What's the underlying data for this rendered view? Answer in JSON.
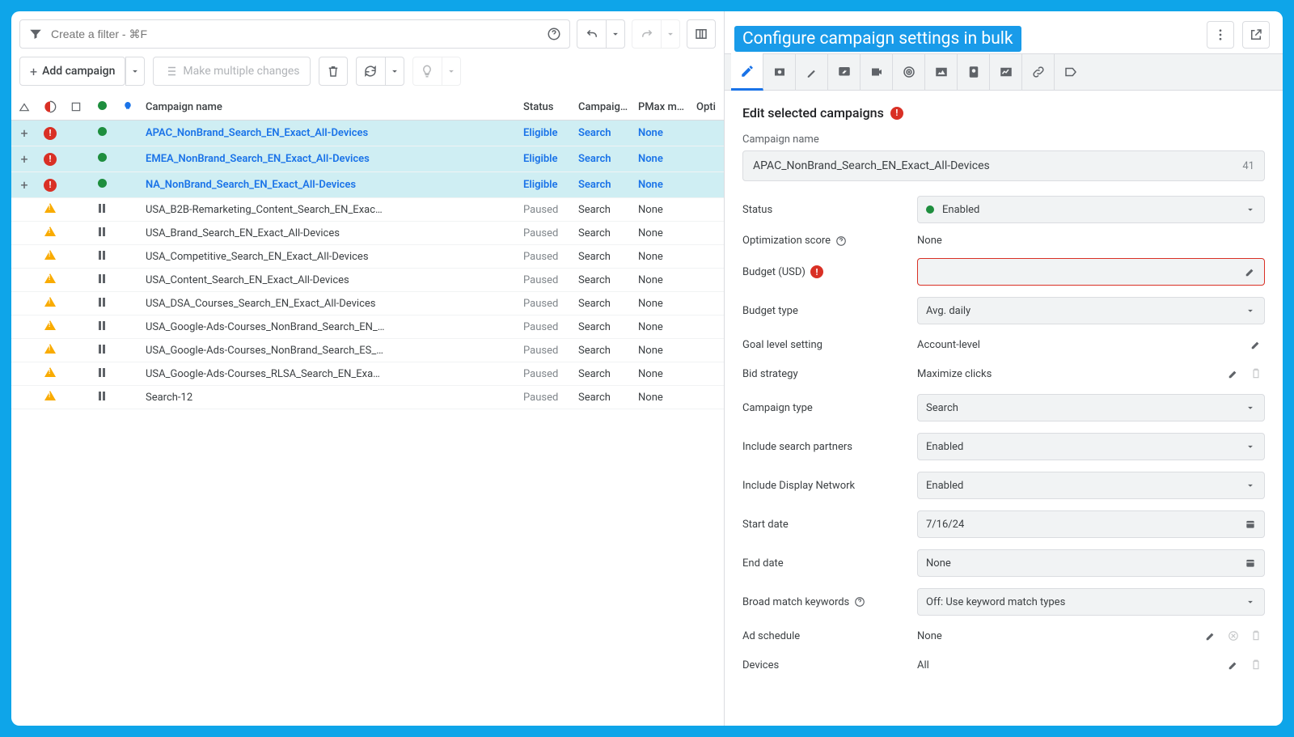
{
  "filter": {
    "placeholder": "Create a filter - ⌘F"
  },
  "toolbar": {
    "add_campaign": "Add campaign",
    "make_multiple": "Make multiple changes"
  },
  "columns": {
    "name": "Campaign name",
    "status": "Status",
    "type": "Campaig…",
    "pmax": "PMax mi…",
    "opt": "Opti"
  },
  "rows": [
    {
      "selected": true,
      "expand": true,
      "alert": "red",
      "dot": "green",
      "name": "APAC_NonBrand_Search_EN_Exact_All-Devices",
      "status": "Eligible",
      "type": "Search",
      "pmax": "None"
    },
    {
      "selected": true,
      "expand": true,
      "alert": "red",
      "dot": "green",
      "name": "EMEA_NonBrand_Search_EN_Exact_All-Devices",
      "status": "Eligible",
      "type": "Search",
      "pmax": "None"
    },
    {
      "selected": true,
      "expand": true,
      "alert": "red",
      "dot": "green",
      "name": "NA_NonBrand_Search_EN_Exact_All-Devices",
      "status": "Eligible",
      "type": "Search",
      "pmax": "None"
    },
    {
      "selected": false,
      "alert": "orange",
      "dot": "pause",
      "name": "USA_B2B-Remarketing_Content_Search_EN_Exac…",
      "status": "Paused",
      "type": "Search",
      "pmax": "None"
    },
    {
      "selected": false,
      "alert": "orange",
      "dot": "pause",
      "name": "USA_Brand_Search_EN_Exact_All-Devices",
      "status": "Paused",
      "type": "Search",
      "pmax": "None"
    },
    {
      "selected": false,
      "alert": "orange",
      "dot": "pause",
      "name": "USA_Competitive_Search_EN_Exact_All-Devices",
      "status": "Paused",
      "type": "Search",
      "pmax": "None"
    },
    {
      "selected": false,
      "alert": "orange",
      "dot": "pause",
      "name": "USA_Content_Search_EN_Exact_All-Devices",
      "status": "Paused",
      "type": "Search",
      "pmax": "None"
    },
    {
      "selected": false,
      "alert": "orange",
      "dot": "pause",
      "name": "USA_DSA_Courses_Search_EN_Exact_All-Devices",
      "status": "Paused",
      "type": "Search",
      "pmax": "None"
    },
    {
      "selected": false,
      "alert": "orange",
      "dot": "pause",
      "name": "USA_Google-Ads-Courses_NonBrand_Search_EN_…",
      "status": "Paused",
      "type": "Search",
      "pmax": "None"
    },
    {
      "selected": false,
      "alert": "orange",
      "dot": "pause",
      "name": "USA_Google-Ads-Courses_NonBrand_Search_ES_…",
      "status": "Paused",
      "type": "Search",
      "pmax": "None"
    },
    {
      "selected": false,
      "alert": "orange",
      "dot": "pause",
      "name": "USA_Google-Ads-Courses_RLSA_Search_EN_Exa…",
      "status": "Paused",
      "type": "Search",
      "pmax": "None"
    },
    {
      "selected": false,
      "alert": "orange",
      "dot": "pause",
      "name": "Search-12",
      "status": "Paused",
      "type": "Search",
      "pmax": "None"
    }
  ],
  "annotation": "Configure campaign settings in bulk",
  "panel": {
    "title": "Edit selected campaigns",
    "campaign_name_label": "Campaign name",
    "campaign_name_value": "APAC_NonBrand_Search_EN_Exact_All-Devices",
    "campaign_name_count": "41",
    "fields": {
      "status": {
        "label": "Status",
        "value": "Enabled"
      },
      "opt_score": {
        "label": "Optimization score",
        "value": "None"
      },
      "budget": {
        "label": "Budget (USD)",
        "value": ""
      },
      "budget_type": {
        "label": "Budget type",
        "value": "Avg. daily"
      },
      "goal": {
        "label": "Goal level setting",
        "value": "Account-level"
      },
      "bid": {
        "label": "Bid strategy",
        "value": "Maximize clicks"
      },
      "ctype": {
        "label": "Campaign type",
        "value": "Search"
      },
      "partners": {
        "label": "Include search partners",
        "value": "Enabled"
      },
      "display": {
        "label": "Include Display Network",
        "value": "Enabled"
      },
      "start_date": {
        "label": "Start date",
        "value": "7/16/24"
      },
      "end_date": {
        "label": "End date",
        "value": "None"
      },
      "broad": {
        "label": "Broad match keywords",
        "value": "Off: Use keyword match types"
      },
      "schedule": {
        "label": "Ad schedule",
        "value": "None"
      },
      "devices": {
        "label": "Devices",
        "value": "All"
      }
    }
  }
}
